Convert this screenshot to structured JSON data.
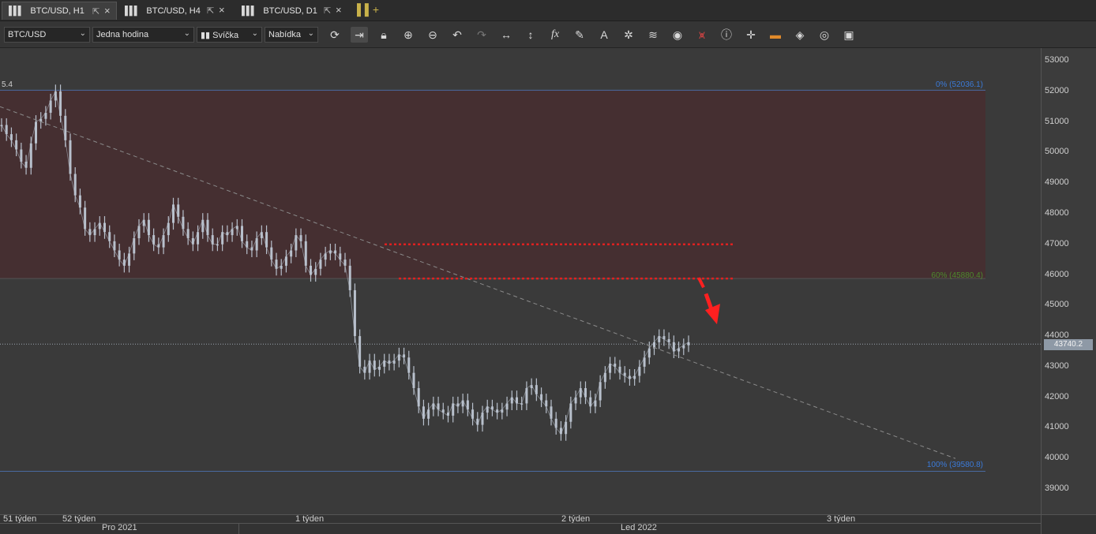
{
  "tabs": [
    {
      "label": "BTC/USD, H1",
      "active": true
    },
    {
      "label": "BTC/USD, H4",
      "active": false
    },
    {
      "label": "BTC/USD, D1",
      "active": false
    }
  ],
  "icons": {
    "tab_chart": "candlestick-chart-icon",
    "tab_popout": "popout-icon",
    "tab_close": "close-icon",
    "new_tab": "add-chart-icon"
  },
  "toolbar": {
    "symbol": "BTC/USD",
    "timeframe": "Jedna hodina",
    "chart_type": "Svíčka",
    "price_side": "Nabídka"
  },
  "toolbar_icons": [
    "refresh-icon",
    "autoscroll-icon",
    "lock-icon",
    "zoom-in-icon",
    "zoom-out-icon",
    "undo-icon",
    "redo-icon",
    "horizontal-scale-icon",
    "vertical-scale-icon",
    "indicators-icon",
    "draw-icon",
    "text-icon",
    "crosshair-icon",
    "layers-icon",
    "eye-icon",
    "signal-icon",
    "info-icon",
    "cursor-cross-icon",
    "highlight-icon",
    "paint-icon",
    "cycle-icon",
    "save-icon"
  ],
  "chart": {
    "left_label": "5.4",
    "current_price": "43740.2",
    "fib_labels": {
      "top": "0% (52036.1)",
      "mid": "60% (45880.4)",
      "bottom": "100% (39580.8)"
    },
    "y_ticks": [
      "53000",
      "52000",
      "51000",
      "50000",
      "49000",
      "48000",
      "47000",
      "46000",
      "45000",
      "44000",
      "43000",
      "42000",
      "41000",
      "40000",
      "39000"
    ],
    "week_labels": [
      "51 týden",
      "52 týden",
      "1 týden",
      "2 týden",
      "3 týden"
    ],
    "month_labels": [
      "Pro 2021",
      "Led 2022"
    ],
    "colors": {
      "upper_zone": "#452f31",
      "lower_zone": "#3a3a3a",
      "candles": "#b8c0cc",
      "fib_line": "#4a6aa0",
      "fib_text_blue": "#3b7ad8",
      "fib_text_green": "#4c8a2d",
      "trendline": "#8a8a8a",
      "dotted_levels": "#e02020",
      "arrow": "#ff2020"
    }
  },
  "chart_data": {
    "type": "line",
    "title": "",
    "symbol": "BTC/USD",
    "timeframe": "H1",
    "ylim": [
      38400,
      53400
    ],
    "x_labels": [
      "51 týden",
      "52 týden",
      "1 týden",
      "2 týden",
      "3 týden"
    ],
    "fib_levels": [
      {
        "label": "0%",
        "value": 52036.1
      },
      {
        "label": "60%",
        "value": 45880.4
      },
      {
        "label": "100%",
        "value": 39580.8
      }
    ],
    "horizontal_levels": [
      47000,
      45880
    ],
    "current_price": 43740.2,
    "series": [
      {
        "name": "BTC/USD",
        "values": [
          50900,
          50600,
          50400,
          50100,
          49700,
          49500,
          50300,
          51000,
          51100,
          51300,
          51700,
          52000,
          51200,
          50400,
          49300,
          48600,
          48200,
          47500,
          47300,
          47500,
          47700,
          47400,
          47100,
          46800,
          46500,
          46300,
          46700,
          47200,
          47600,
          47800,
          47300,
          47000,
          46900,
          47300,
          47700,
          48300,
          47900,
          47500,
          47200,
          47000,
          47400,
          47800,
          47300,
          47000,
          47000,
          47400,
          47300,
          47500,
          47600,
          47100,
          46900,
          46800,
          47200,
          47400,
          46900,
          46500,
          46200,
          46300,
          46600,
          46800,
          47300,
          47100,
          46300,
          46000,
          46200,
          46500,
          46700,
          46800,
          46700,
          46500,
          46300,
          45500,
          44000,
          43000,
          42800,
          43200,
          42900,
          43000,
          43200,
          43100,
          43200,
          43400,
          43300,
          42800,
          42300,
          41700,
          41300,
          41600,
          41800,
          41600,
          41500,
          41400,
          41800,
          41700,
          41900,
          41600,
          41300,
          41100,
          41500,
          41700,
          41600,
          41500,
          41600,
          41800,
          42000,
          41800,
          41800,
          42300,
          42400,
          42100,
          41900,
          41700,
          41300,
          41000,
          40800,
          41200,
          41800,
          42000,
          42300,
          42000,
          41700,
          41900,
          42500,
          42800,
          43100,
          43000,
          42800,
          42700,
          42600,
          42700,
          43000,
          43300,
          43600,
          43800,
          44000,
          43900,
          43800,
          43500,
          43600,
          43700,
          43800
        ]
      }
    ]
  }
}
